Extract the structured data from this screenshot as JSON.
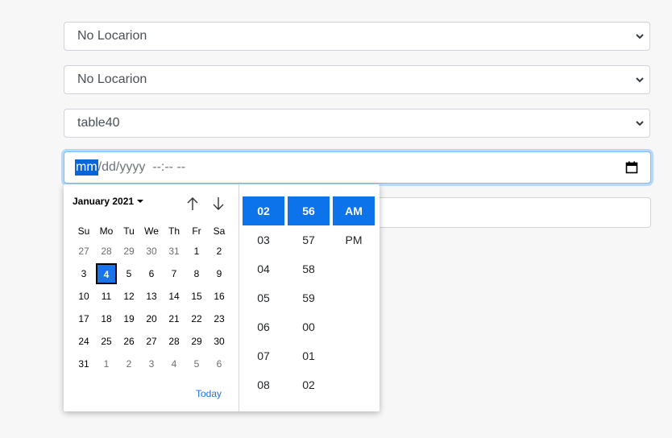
{
  "form": {
    "select1": "No Locarion",
    "select2": "No Locarion",
    "select3": "table40",
    "datetime": {
      "highlighted_segment": "mm",
      "rest": "/dd/yyyy  --:-- --"
    }
  },
  "calendar": {
    "month_label": "January 2021",
    "weekdays": [
      "Su",
      "Mo",
      "Tu",
      "We",
      "Th",
      "Fr",
      "Sa"
    ],
    "weeks": [
      [
        "27",
        "28",
        "29",
        "30",
        "31",
        "1",
        "2"
      ],
      [
        "3",
        "4",
        "5",
        "6",
        "7",
        "8",
        "9"
      ],
      [
        "10",
        "11",
        "12",
        "13",
        "14",
        "15",
        "16"
      ],
      [
        "17",
        "18",
        "19",
        "20",
        "21",
        "22",
        "23"
      ],
      [
        "24",
        "25",
        "26",
        "27",
        "28",
        "29",
        "30"
      ],
      [
        "31",
        "1",
        "2",
        "3",
        "4",
        "5",
        "6"
      ]
    ],
    "selected_day": "4",
    "today_label": "Today"
  },
  "time": {
    "hours": [
      "02",
      "03",
      "04",
      "05",
      "06",
      "07",
      "08"
    ],
    "minutes": [
      "56",
      "57",
      "58",
      "59",
      "00",
      "01",
      "02"
    ],
    "ampm": [
      "AM",
      "PM"
    ]
  },
  "colors": {
    "accent": "#1a73e8",
    "focus_border": "#80bdff"
  }
}
